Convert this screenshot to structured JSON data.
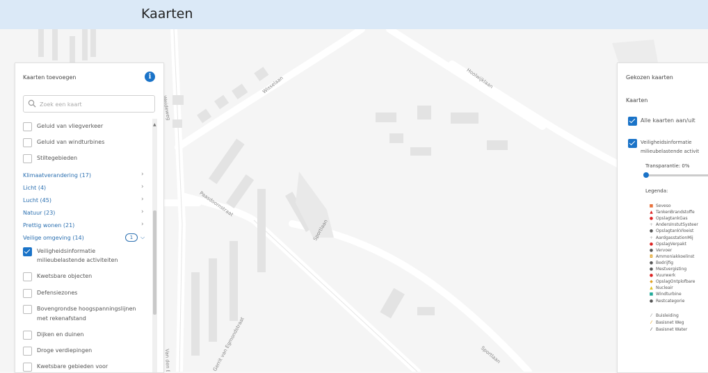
{
  "header": {
    "title": "Kaarten"
  },
  "map": {
    "streets": [
      "Wisselaan",
      "Paasdoornstraat",
      "Sportlaan",
      "Weideweg",
      "Van den Be",
      "Gerrit van Egmondstraat",
      "Hoolwijklaan",
      "Sportlaan"
    ]
  },
  "left_panel": {
    "title": "Kaarten toevoegen",
    "search_placeholder": "Zoek een kaart",
    "items_top": [
      {
        "label": "Geluid van vliegverkeer",
        "checked": false
      },
      {
        "label": "Geluid van windturbines",
        "checked": false
      },
      {
        "label": "Stiltegebieden",
        "checked": false
      }
    ],
    "categories": [
      {
        "label": "Klimaatverandering (17)"
      },
      {
        "label": "Licht (4)"
      },
      {
        "label": "Lucht (45)"
      },
      {
        "label": "Natuur (23)"
      },
      {
        "label": "Prettig wonen (21)"
      }
    ],
    "open_category": {
      "label": "Veilige omgeving (14)",
      "badge": "1"
    },
    "items_bottom": [
      {
        "label1": "Veiligheidsinformatie",
        "label2": "milieubelastende activiteiten",
        "checked": true
      },
      {
        "label1": "Kwetsbare objecten",
        "label2": "",
        "checked": false
      },
      {
        "label1": "Defensiezones",
        "label2": "",
        "checked": false
      },
      {
        "label1": "Bovengrondse hoogspanningslijnen",
        "label2": "met rekenafstand",
        "checked": false
      },
      {
        "label1": "Dijken en duinen",
        "label2": "",
        "checked": false
      },
      {
        "label1": "Droge verdiepingen",
        "label2": "",
        "checked": false
      },
      {
        "label1": "Kwetsbare gebieden voor",
        "label2": "",
        "checked": false
      }
    ]
  },
  "right_panel": {
    "title": "Gekozen kaarten",
    "subtitle": "Kaarten",
    "toggle_all": "Alle kaarten aan/uit",
    "layer_line1": "Veiligheidsinformatie",
    "layer_line2": "milieubelastende activit",
    "transparency_label": "Transparantie: 0%",
    "transparency_value": 0,
    "legend_title": "Legenda:",
    "legend": [
      {
        "label": "Seveso",
        "symbol": "■",
        "color": "#e8703a"
      },
      {
        "label": "TankenBrandstoffe",
        "symbol": "▲",
        "color": "#d22"
      },
      {
        "label": "OpslagtankGas",
        "symbol": "●",
        "color": "#d22"
      },
      {
        "label": "AndersInstutSysteer",
        "symbol": "+",
        "color": "#aaa"
      },
      {
        "label": "OpslagtankVloeist",
        "symbol": "●",
        "color": "#555"
      },
      {
        "label": "AardgasstationMij",
        "symbol": "+",
        "color": "#aaa"
      },
      {
        "label": "OpslagVerpakt",
        "symbol": "●",
        "color": "#d22"
      },
      {
        "label": "Vervoer",
        "symbol": "●",
        "color": "#555"
      },
      {
        "label": "Ammoniakkoelinst",
        "symbol": "◘",
        "color": "#e0a020"
      },
      {
        "label": "Bedrijfig",
        "symbol": "●",
        "color": "#555"
      },
      {
        "label": "Mestvergisting",
        "symbol": "●",
        "color": "#555"
      },
      {
        "label": "Vuurwerk",
        "symbol": "●",
        "color": "#d22"
      },
      {
        "label": "OpslagOntplofbare",
        "symbol": "◆",
        "color": "#e0a020"
      },
      {
        "label": "Nucleair",
        "symbol": "▲",
        "color": "#e0c020"
      },
      {
        "label": "Windturbine",
        "symbol": "■",
        "color": "#2a9"
      },
      {
        "label": "Restcategorie",
        "symbol": "●",
        "color": "#555"
      }
    ],
    "legend_lines": [
      {
        "label": "Buisleiding",
        "color": "#999"
      },
      {
        "label": "Basisnet Weg",
        "color": "#e0a020"
      },
      {
        "label": "Basisnet Water",
        "color": "#555"
      }
    ]
  }
}
